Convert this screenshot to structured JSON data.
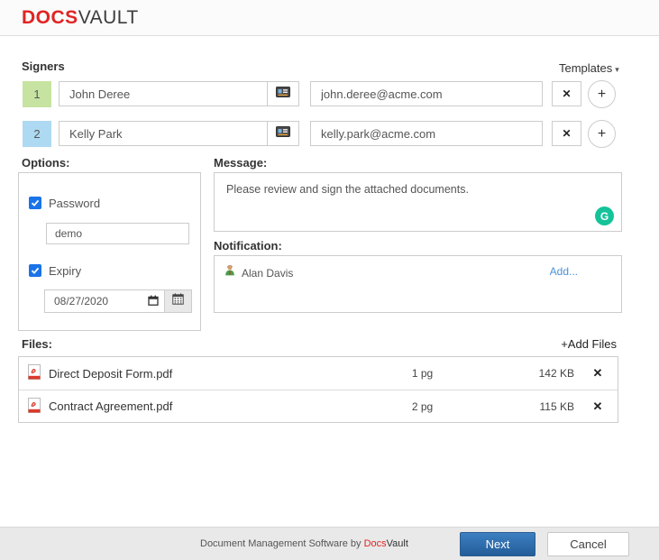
{
  "header": {
    "logo_docs": "DOCS",
    "logo_vault": "VAULT"
  },
  "colors": {
    "brand_red": "#e02424",
    "accent_blue": "#1a73e8",
    "badge_green": "#c7e3a1",
    "badge_blue": "#aed9f2",
    "link_blue": "#4a90d9",
    "grammarly_green": "#15c39a",
    "next_button_blue": "#2e6da4",
    "pdf_red": "#d93a2b"
  },
  "icons": {
    "remove": "✕",
    "add": "+",
    "caret": "▾",
    "grammarly": "G",
    "add_files_plus": "+"
  },
  "signers": {
    "label": "Signers",
    "templates_label": "Templates",
    "rows": [
      {
        "order": "1",
        "name": "John Deree",
        "email": "john.deree@acme.com"
      },
      {
        "order": "2",
        "name": "Kelly Park",
        "email": "kelly.park@acme.com"
      }
    ]
  },
  "options": {
    "label": "Options:",
    "password": {
      "label": "Password",
      "checked": true,
      "value": "demo"
    },
    "expiry": {
      "label": "Expiry",
      "checked": true,
      "value": "08/27/2020"
    }
  },
  "message": {
    "label": "Message:",
    "value": "Please review and sign the attached documents."
  },
  "notification": {
    "label": "Notification:",
    "recipients": [
      {
        "name": "Alan Davis"
      }
    ],
    "add_label": "Add..."
  },
  "files": {
    "label": "Files:",
    "add_files_label": "Add Files",
    "items": [
      {
        "name": "Direct Deposit Form.pdf",
        "pages": "1 pg",
        "size": "142 KB"
      },
      {
        "name": "Contract Agreement.pdf",
        "pages": "2 pg",
        "size": "115 KB"
      }
    ]
  },
  "footer": {
    "tagline_prefix": "Document Management Software by ",
    "brand_docs": "Docs",
    "brand_vault": "Vault",
    "next_label": "Next",
    "cancel_label": "Cancel"
  }
}
